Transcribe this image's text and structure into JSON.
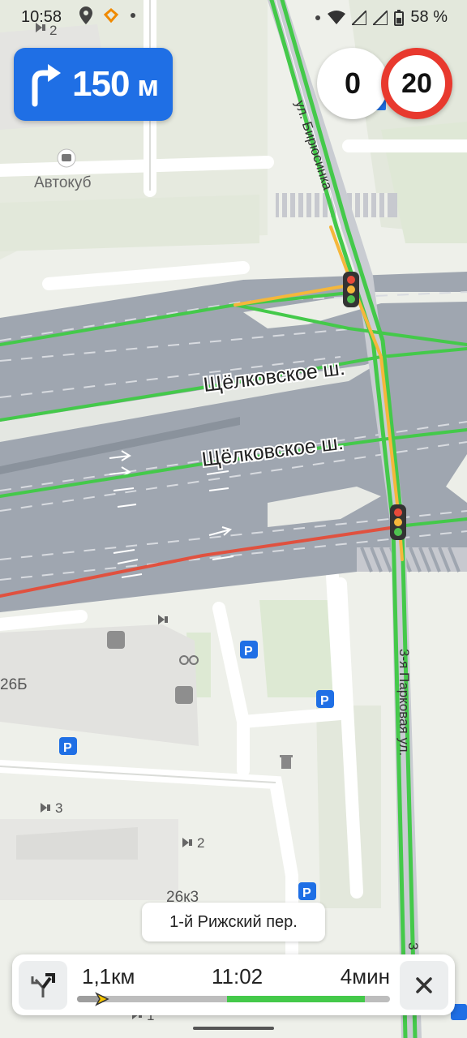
{
  "status_bar": {
    "time": "10:58",
    "battery": "58 %"
  },
  "maneuver": {
    "icon": "turn-right-icon",
    "distance_value": "150",
    "distance_unit": "м"
  },
  "speed": {
    "current": "0",
    "limit": "20"
  },
  "map_labels": {
    "poi_autokub": "Автокуб",
    "street_birusinka": "ул. Бирюсинка",
    "street_schelkovskoe_1": "Щёлковское ш.",
    "street_schelkovskoe_2": "Щёлковское ш.",
    "street_3_parkovaya": "3-я Парковая ул.",
    "building_26b": "26Б",
    "building_26k3": "26к3",
    "entrance_2_top": "2",
    "entrance_3": "3",
    "entrance_2": "2",
    "entrance_1": "1",
    "bottom_right_partial": "3"
  },
  "next_street": "1-й Рижский пер.",
  "route_panel": {
    "remaining_distance": "1,1км",
    "arrival_time": "11:02",
    "remaining_time": "4мин",
    "progress_fraction": 0.07
  },
  "colors": {
    "maneuver_bg": "#1f6fe5",
    "speed_limit_ring": "#e8392e",
    "traffic_free": "#44c94a",
    "traffic_slow": "#f5b73b",
    "traffic_jam": "#e0513f",
    "road": "#9fa6b0"
  }
}
